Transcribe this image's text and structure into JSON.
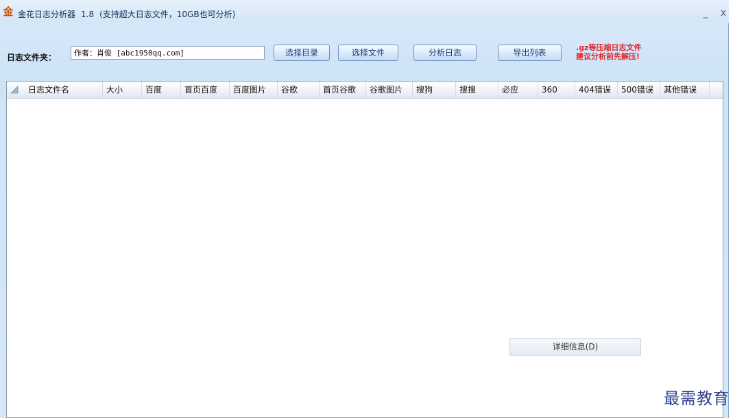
{
  "window": {
    "title": "金花日志分析器",
    "version": "1.8",
    "note": "(支持超大日志文件，10GB也可分析)",
    "minimize": "_",
    "close": "x"
  },
  "toolbar": {
    "folder_label": "日志文件夹：",
    "folder_value": "作者：肖俊 [abc1950qq.com]",
    "select_dir": "选择目录",
    "select_file": "选择文件",
    "analyze": "分析日志",
    "export": "导出列表",
    "warning_line1": ".gz等压缩日志文件",
    "warning_line2": "建议分析前先解压!"
  },
  "table": {
    "columns": [
      "日志文件名",
      "大小",
      "百度",
      "首页百度",
      "百度图片",
      "谷歌",
      "首页谷歌",
      "谷歌图片",
      "搜狗",
      "搜搜",
      "必应",
      "360",
      "404错误",
      "500错误",
      "其他错误"
    ],
    "rows": []
  },
  "details_button": "详细信息(D)",
  "watermark": "最需教育",
  "colors": {
    "warning": "#e0262b",
    "app_icon": "#d24a00"
  }
}
